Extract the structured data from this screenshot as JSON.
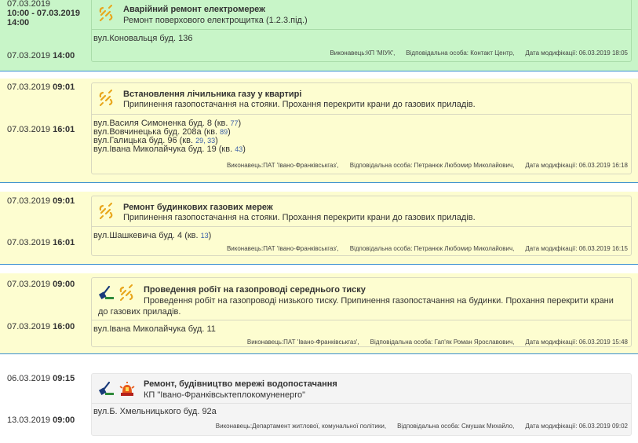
{
  "records": [
    {
      "start_date": "07.03.2019",
      "start_time_line": "10:00 - 07.03.2019",
      "start_time_line2": "14:00",
      "end_date": "07.03.2019",
      "end_time": "14:00",
      "title": "Аварійний ремонт електромереж",
      "desc": "Ремонт поверхового електрощитка (1.2.3.під.)",
      "addresses": [
        {
          "street": "вул.Коновальця буд. 136",
          "apt": ""
        }
      ],
      "executor": "Виконавець:КП 'МІУК',",
      "responsible": "Відповідальна особа: Контакт Центр,",
      "modified": "Дата модифікації: 06.03.2019 18:05"
    },
    {
      "start_date": "07.03.2019",
      "start_time": "09:01",
      "end_date": "07.03.2019",
      "end_time": "16:01",
      "title": "Встановлення лічильника газу у квартирі",
      "desc": "Припинення газопостачання на стояки. Прохання перекрити крани до газових приладів.",
      "addresses": [
        {
          "street": "вул.Василя Симоненка буд. 8 (кв. ",
          "apt": "77",
          "close": ")"
        },
        {
          "street": "вул.Вовчинецька буд. 208а (кв. ",
          "apt": "89",
          "close": ")"
        },
        {
          "street": "вул.Галицька буд. 96 (кв. ",
          "apt": "29, 33",
          "close": ")"
        },
        {
          "street": "вул.Івана Миколайчука буд. 19 (кв. ",
          "apt": "43",
          "close": ")"
        }
      ],
      "executor": "Виконавець:ПАТ 'Івано-Франківськгаз',",
      "responsible": "Відповідальна особа: Петранюк Любомир Миколайович,",
      "modified": "Дата модифікації: 06.03.2019 16:18"
    },
    {
      "start_date": "07.03.2019",
      "start_time": "09:01",
      "end_date": "07.03.2019",
      "end_time": "16:01",
      "title": "Ремонт будинкових газових мереж",
      "desc": "Припинення газопостачання на стояки. Прохання перекрити крани до газових приладів.",
      "addresses": [
        {
          "street": "вул.Шашкевича буд. 4 (кв. ",
          "apt": "13",
          "close": ")"
        }
      ],
      "executor": "Виконавець:ПАТ 'Івано-Франківськгаз',",
      "responsible": "Відповідальна особа: Петранюк Любомир Миколайович,",
      "modified": "Дата модифікації: 06.03.2019 16:15"
    },
    {
      "start_date": "07.03.2019",
      "start_time": "09:00",
      "end_date": "07.03.2019",
      "end_time": "16:00",
      "title": "Проведення робіт на газопроводі середнього тиску",
      "desc": "Проведення робіт на газопроводі низького тиску. Припинення газопостачання на будинки. Прохання перекрити крани до газових приладів.",
      "addresses": [
        {
          "street": "вул.Івана Миколайчука буд. 11",
          "apt": ""
        }
      ],
      "executor": "Виконавець:ПАТ 'Івано-Франківськгаз',",
      "responsible": "Відповідальна особа: Гап'як Роман Ярославович,",
      "modified": "Дата модифікації: 06.03.2019 15:48"
    },
    {
      "start_date": "06.03.2019",
      "start_time": "09:15",
      "end_date": "13.03.2019",
      "end_time": "09:00",
      "title": "Ремонт, будівництво мережі водопостачання",
      "desc": "КП \"Івано-Франківськтеплокомуненерго\"",
      "addresses": [
        {
          "street": "вул.Б. Хмельницького буд. 92а",
          "apt": ""
        }
      ],
      "executor": "Виконавець:Департамент житлової, комунальної політики,",
      "responsible": "Відповідальна особа: Смушак Михайло,",
      "modified": "Дата модифікації: 06.03.2019 09:02"
    }
  ]
}
